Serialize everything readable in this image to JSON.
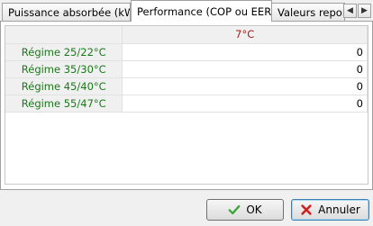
{
  "tabs": [
    {
      "label": "Puissance absorbée (kW)",
      "active": false
    },
    {
      "label": "Performance (COP ou EER)",
      "active": true
    },
    {
      "label": "Valeurs report",
      "active": false
    }
  ],
  "tab_scroll": {
    "left": "◀",
    "right": "▶"
  },
  "grid": {
    "column_header": "7°C",
    "rows": [
      {
        "label": "Régime 25/22°C",
        "value": "0"
      },
      {
        "label": "Régime 35/30°C",
        "value": "0"
      },
      {
        "label": "Régime 45/40°C",
        "value": "0"
      },
      {
        "label": "Régime 55/47°C",
        "value": "0"
      }
    ]
  },
  "buttons": {
    "ok_label": "OK",
    "cancel_label": "Annuler"
  },
  "colors": {
    "row_header_text": "#1a7a1a",
    "column_header_text": "#a02020",
    "ok_icon": "#3aa63a",
    "cancel_icon": "#d02020"
  }
}
